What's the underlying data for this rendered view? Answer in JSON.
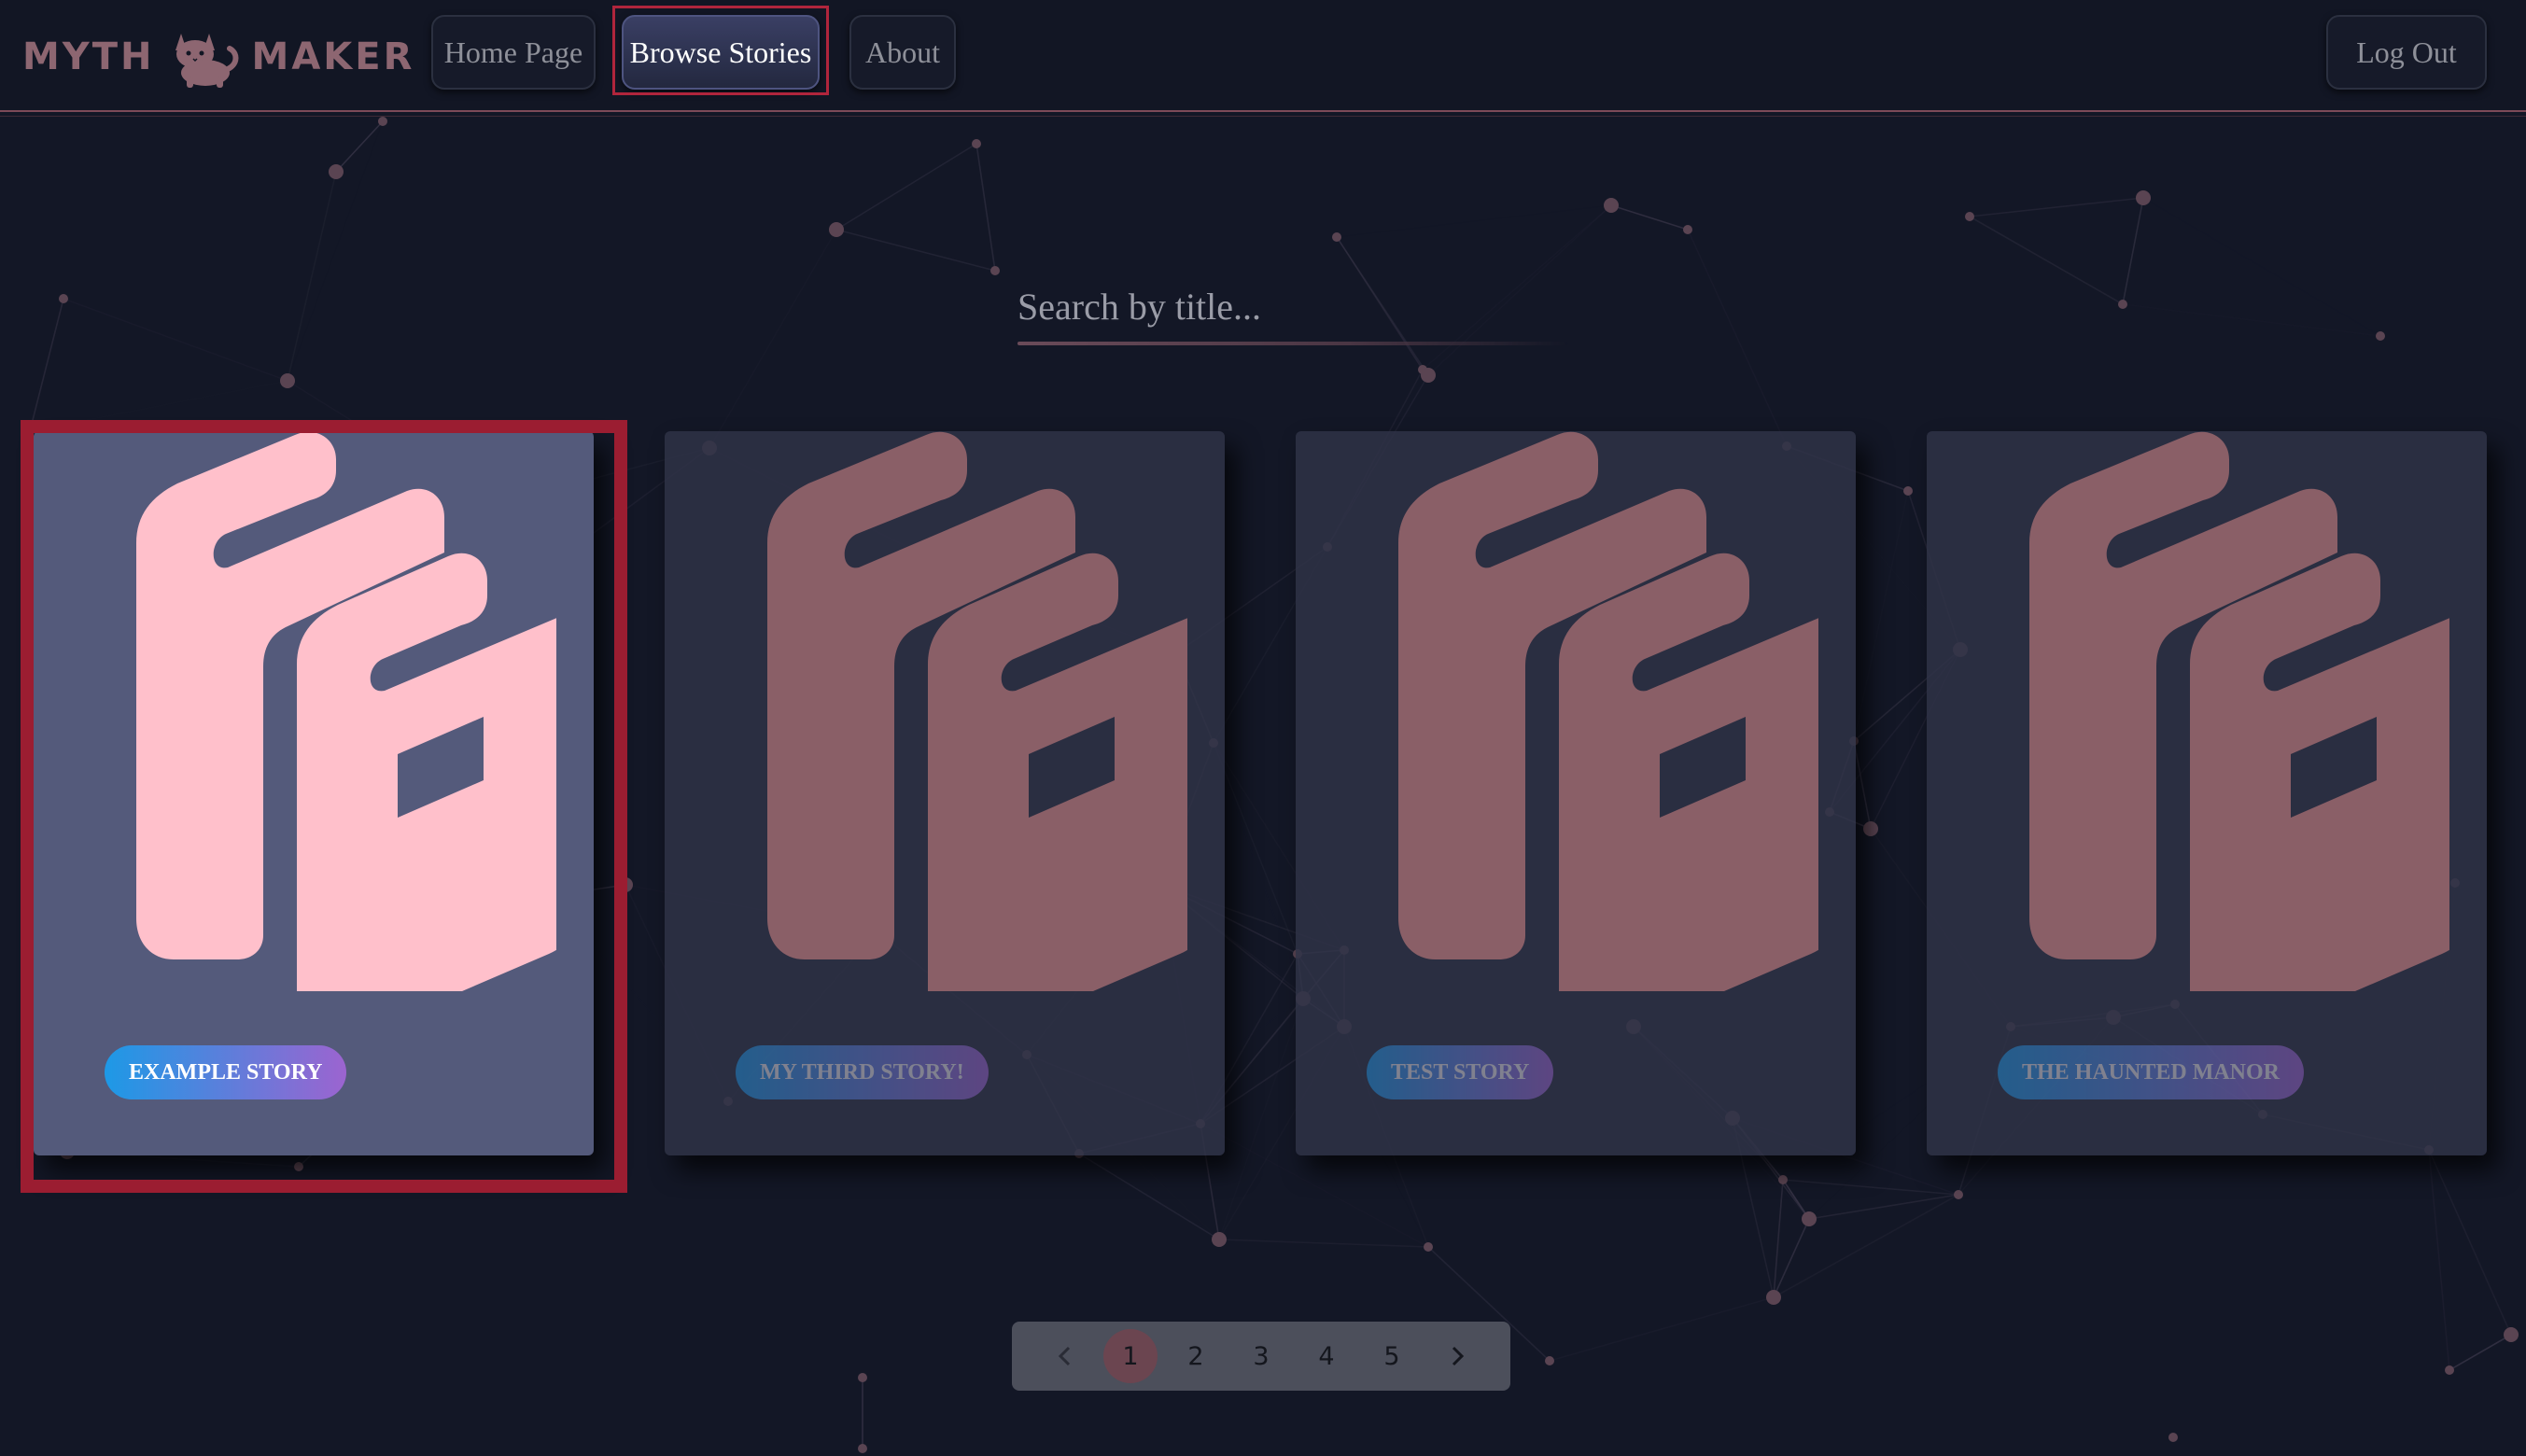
{
  "header": {
    "logo_left": "MYTH",
    "logo_right": "MAKER",
    "logo_icon": "cat-icon",
    "nav": {
      "home": "Home Page",
      "browse": "Browse Stories",
      "about": "About",
      "logout": "Log Out"
    }
  },
  "search": {
    "placeholder": "Search by title..."
  },
  "cards": [
    {
      "title": "Example Story",
      "icon": "books-icon",
      "selected": true
    },
    {
      "title": "My Third Story!",
      "icon": "books-icon",
      "selected": false
    },
    {
      "title": "Test Story",
      "icon": "books-icon",
      "selected": false
    },
    {
      "title": "The Haunted Manor",
      "icon": "books-icon",
      "selected": false
    }
  ],
  "pagination": {
    "prev_icon": "chevron-left-icon",
    "next_icon": "chevron-right-icon",
    "pages": [
      "1",
      "2",
      "3",
      "4",
      "5"
    ],
    "current": "1"
  },
  "colors": {
    "background": "#131726",
    "accent_pink": "#ffc0cb",
    "dim_pink": "#8a5f67",
    "focus_red": "#9b1d31",
    "tag_gradient_start": "#1d99e6",
    "tag_gradient_end": "#9c64d0"
  }
}
